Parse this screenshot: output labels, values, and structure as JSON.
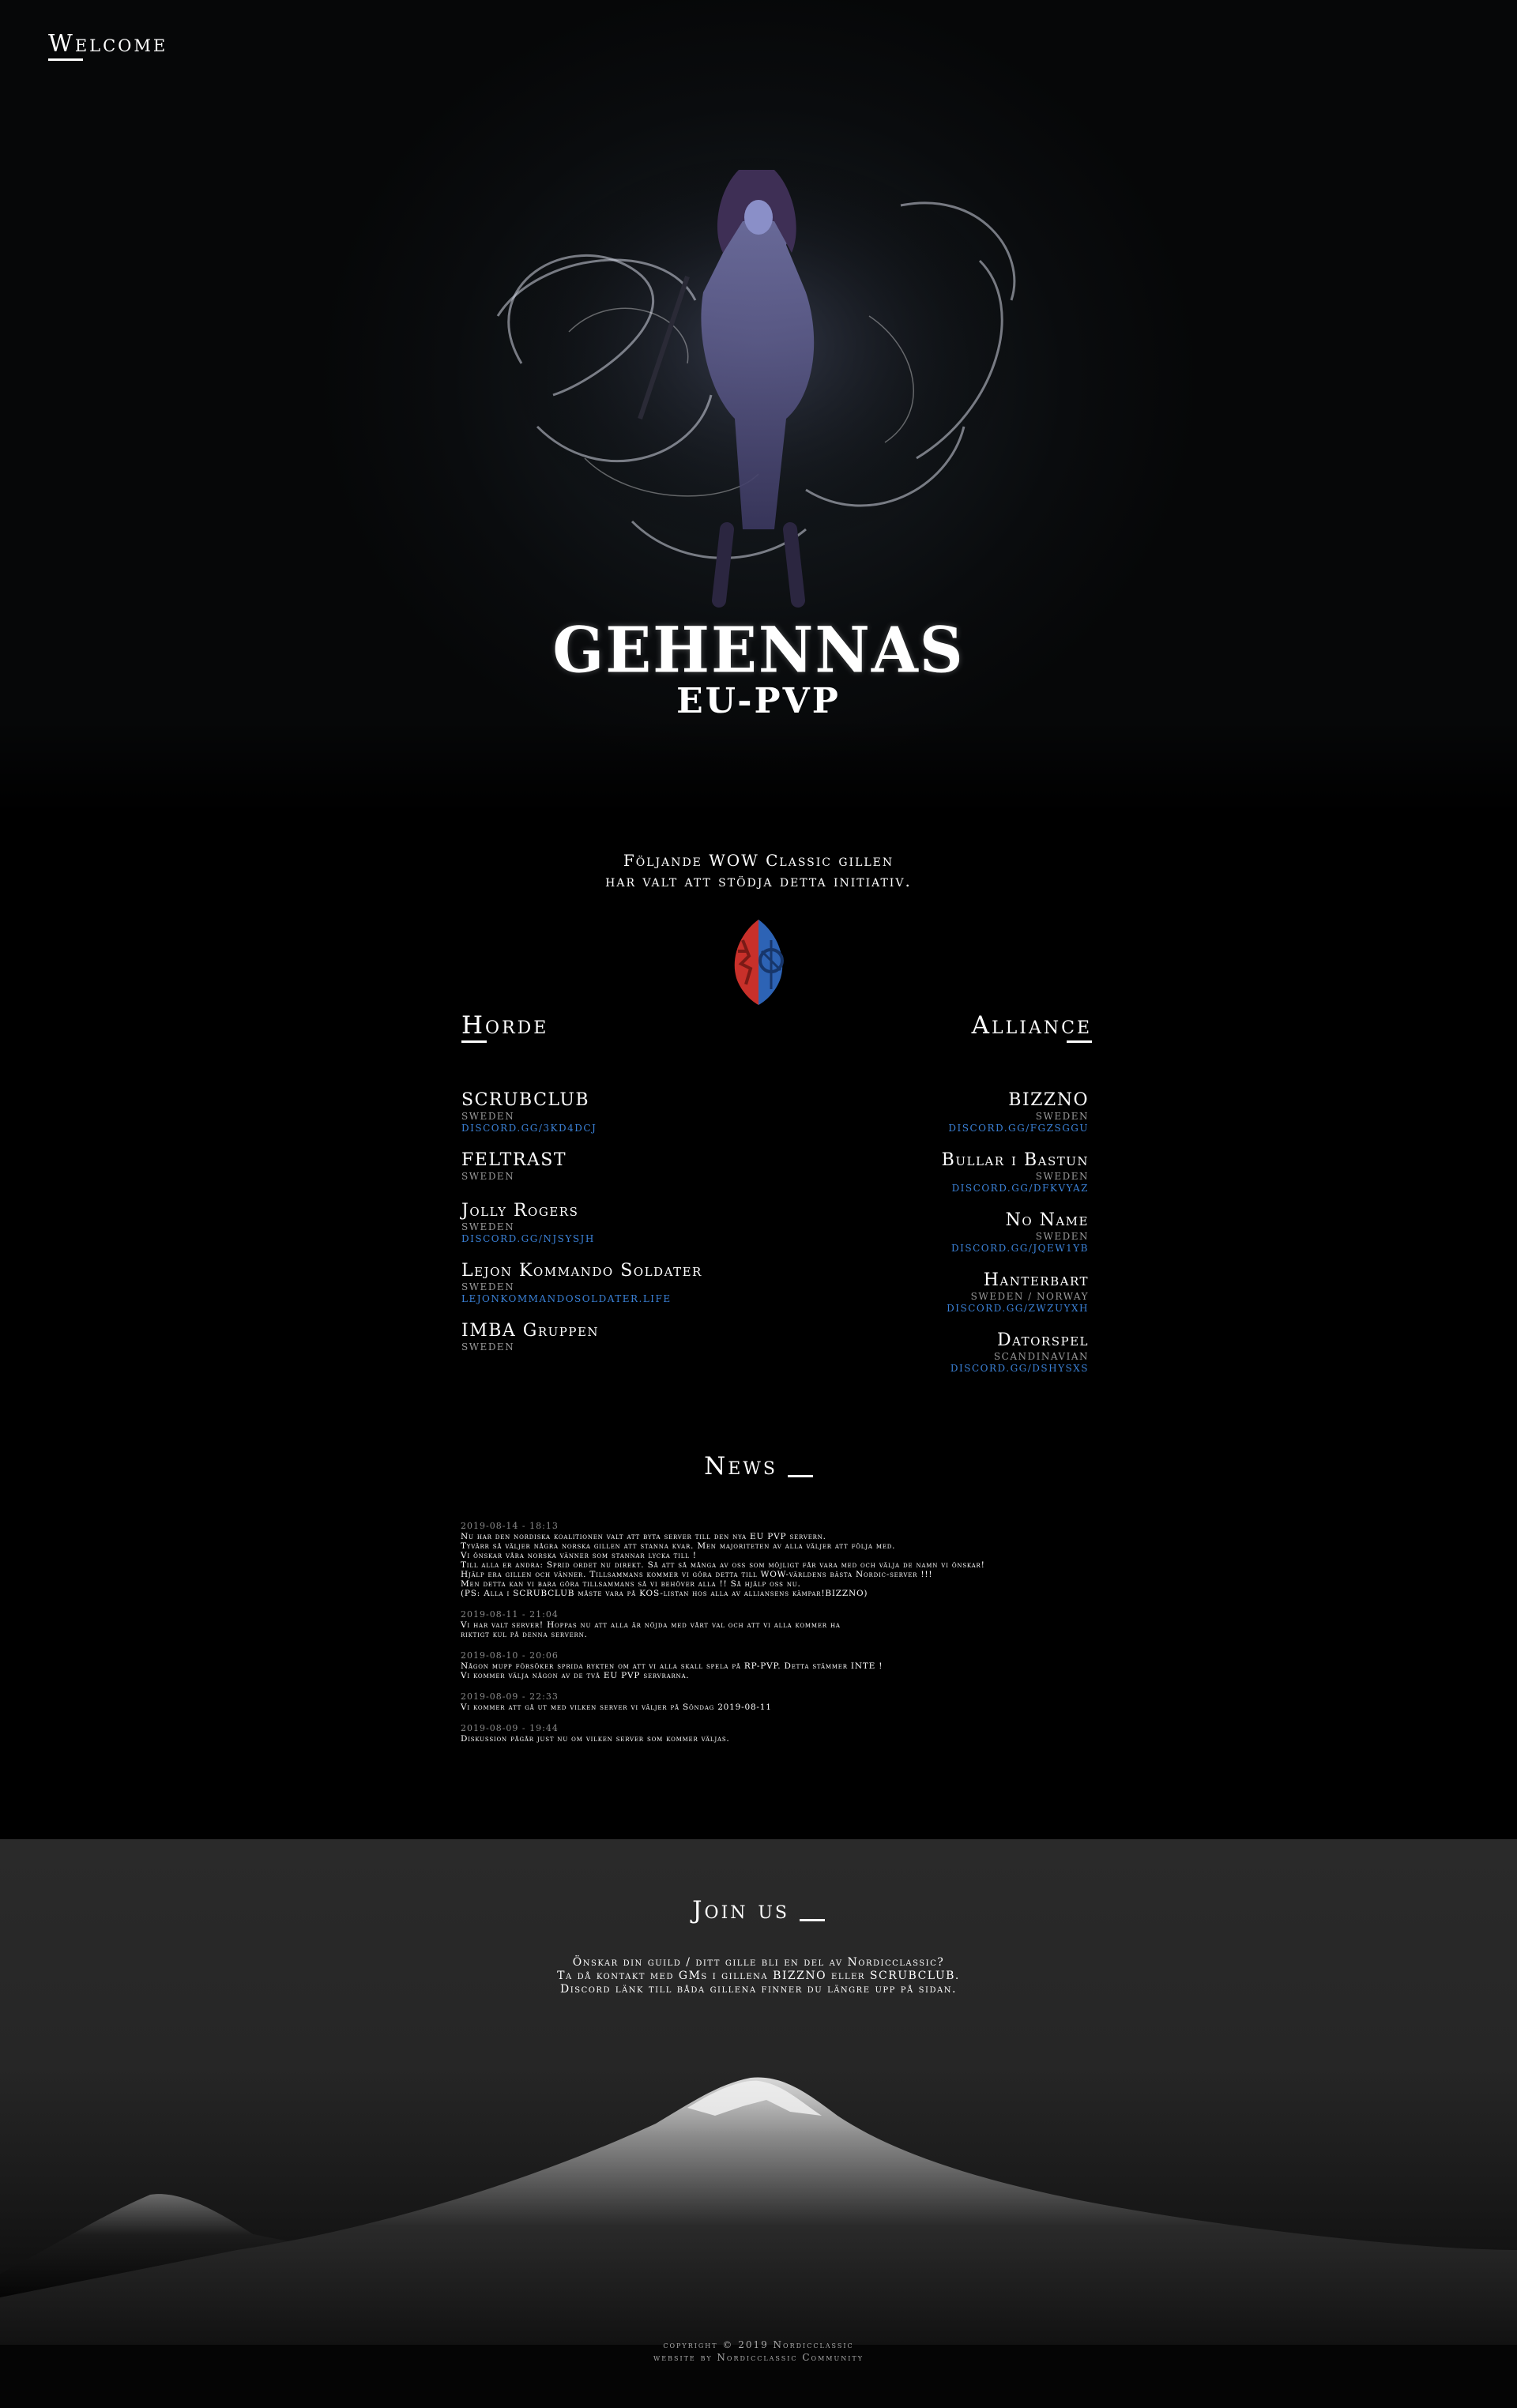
{
  "nav": {
    "welcome": "Welcome"
  },
  "hero": {
    "title": "GEHENNAS",
    "subtitle": "EU-PVP"
  },
  "intro": {
    "line1": "Följande WOW Classic gillen",
    "line2": "har valt att stödja detta initiativ."
  },
  "icons": {
    "faction_logo": "horde-alliance-emblem-icon"
  },
  "horde": {
    "heading": "Horde",
    "guilds": [
      {
        "name": "SCRUBCLUB",
        "country": "SWEDEN",
        "link": "DISCORD.GG/3KD4DCJ"
      },
      {
        "name": "FELTRAST",
        "country": "SWEDEN"
      },
      {
        "name": "Jolly Rogers",
        "country": "SWEDEN",
        "link": "DISCORD.GG/NJSYSJH"
      },
      {
        "name": "Lejon Kommando Soldater",
        "country": "SWEDEN",
        "link": "LEJONKOMMANDOSOLDATER.LIFE"
      },
      {
        "name": "IMBA Gruppen",
        "country": "SWEDEN"
      }
    ]
  },
  "alliance": {
    "heading": "Alliance",
    "guilds": [
      {
        "name": "BIZZNO",
        "country": "SWEDEN",
        "link": "DISCORD.GG/FGZSGGU"
      },
      {
        "name": "Bullar i Bastun",
        "country": "SWEDEN",
        "link": "DISCORD.GG/DFKVYAZ"
      },
      {
        "name": "No Name",
        "country": "SWEDEN",
        "link": "DISCORD.GG/JQEW1YB"
      },
      {
        "name": "Hanterbart",
        "country": "SWEDEN / NORWAY",
        "link": "DISCORD.GG/ZWZUYXH"
      },
      {
        "name": "Datorspel",
        "country": "SCANDINAVIAN",
        "link": "DISCORD.GG/DSHYSXS"
      }
    ]
  },
  "news": {
    "heading": "News",
    "items": [
      {
        "date": "2019-08-14 - 18:13",
        "text": "Nu har den nordiska koalitionen valt att byta server till den nya EU PVP servern.\nTyvärr så väljer några norska gillen att stanna kvar. Men majoriteten av alla väljer att följa med.\nVi önskar våra norska vänner som stannar lycka till !\nTill alla er andra: Sprid ordet nu direkt. Så att så många av oss som möjligt får vara med och välja de namn vi önskar!\nHjälp era gillen och vänner. Tillsammans kommer vi göra detta till WOW-världens bästa Nordic-server !!!\nMen detta kan vi bara göra tillsammans så vi behöver alla !! Så hjälp oss nu.\n(PS: Alla i SCRUBCLUB måste vara på KOS-listan hos alla av alliansens kämpar!BIZZNO)"
      },
      {
        "date": "2019-08-11 - 21:04",
        "text": "Vi har valt server! Hoppas nu att alla är nöjda med vårt val och att vi alla kommer ha\nriktigt kul på denna servern."
      },
      {
        "date": "2019-08-10 - 20:06",
        "text": "Någon mupp försöker sprida rykten om att vi alla skall spela på RP-PVP. Detta stämmer INTE !\nVi kommer välja någon av de två EU PVP servrarna."
      },
      {
        "date": "2019-08-09 - 22:33",
        "text": "Vi kommer att gå ut med vilken server vi väljer på Söndag 2019-08-11"
      },
      {
        "date": "2019-08-09 - 19:44",
        "text": "Diskussion pågår just nu om vilken server som kommer väljas."
      }
    ]
  },
  "join": {
    "heading": "Join us",
    "text": "Önskar din guild / ditt gille bli en del av Nordicclassic?\nTa då kontakt med GMs i gillena BIZZNO eller SCRUBCLUB.\nDiscord länk till båda gillena finner du längre upp på sidan."
  },
  "footer": {
    "line1": "copyright © 2019 Nordicclassic",
    "line2": "website by Nordicclassic Community"
  },
  "colors": {
    "link": "#3b82d8",
    "background": "#000000",
    "muted": "#9a9a9a"
  }
}
